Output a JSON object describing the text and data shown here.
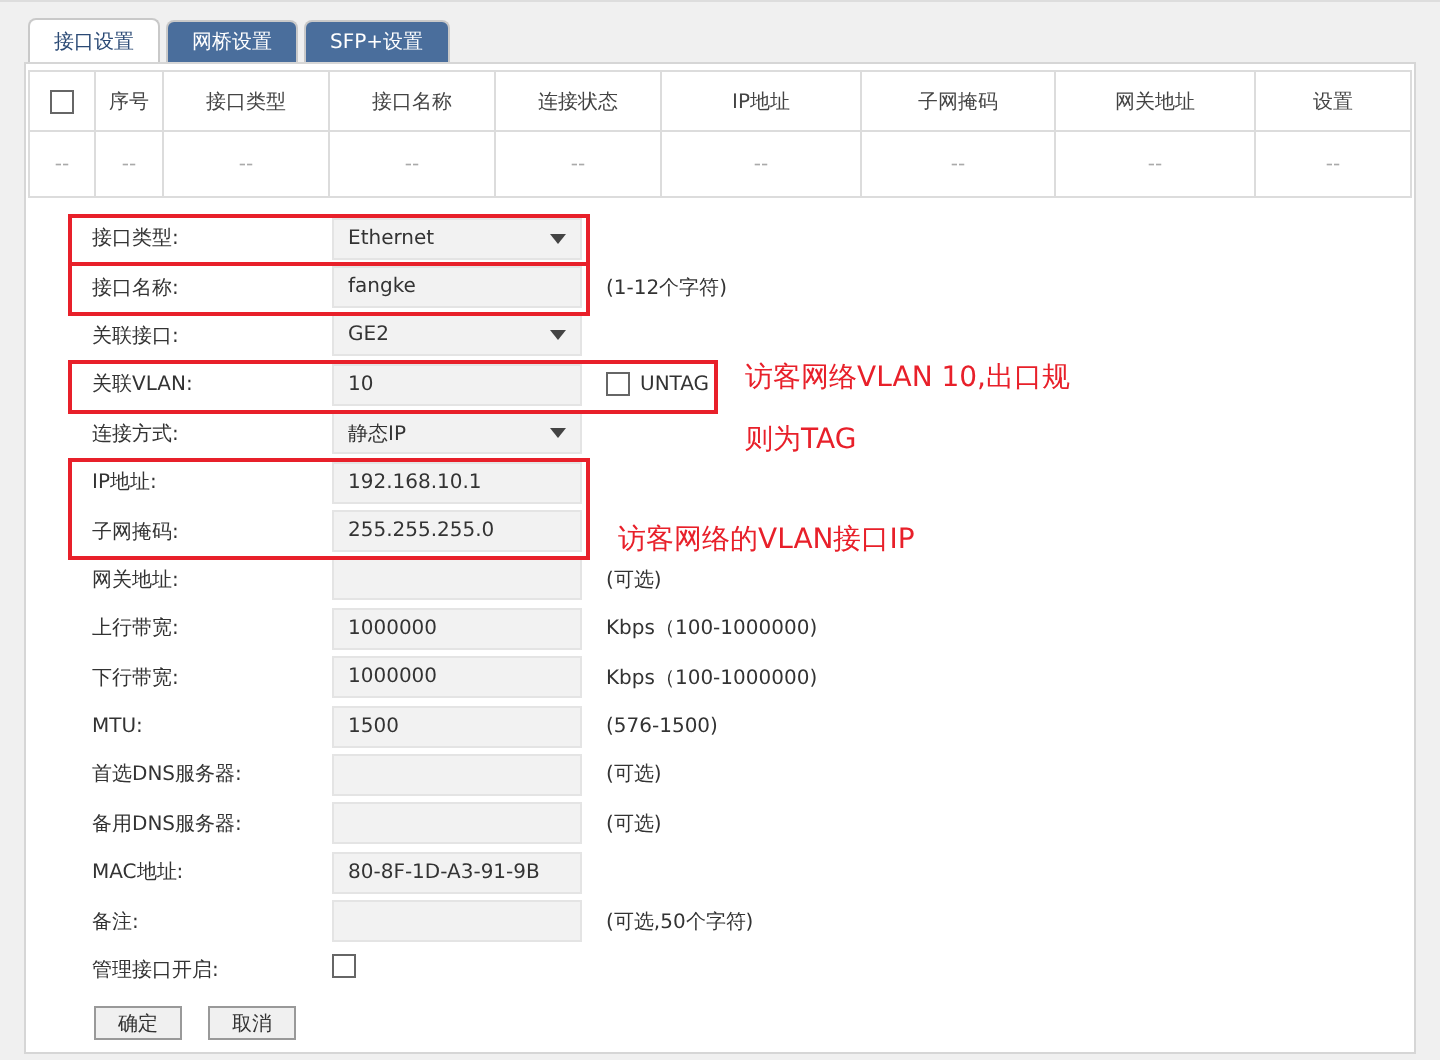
{
  "tabs": [
    {
      "label": "接口设置",
      "selected": true
    },
    {
      "label": "网桥设置",
      "selected": false
    },
    {
      "label": "SFP+设置",
      "selected": false
    }
  ],
  "table": {
    "select_all": {
      "checked": false
    },
    "columns": [
      "",
      "序号",
      "接口类型",
      "接口名称",
      "连接状态",
      "IP地址",
      "子网掩码",
      "网关地址",
      "设置"
    ],
    "rows": [
      [
        "--",
        "--",
        "--",
        "--",
        "--",
        "--",
        "--",
        "--",
        "--"
      ]
    ]
  },
  "form": {
    "rows": [
      {
        "kind": "highlight",
        "fields": [
          {
            "kind": "select",
            "label": "接口类型:",
            "value": "Ethernet"
          }
        ]
      },
      {
        "kind": "highlight",
        "fields": [
          {
            "kind": "input",
            "label": "接口名称:",
            "value": "fangke",
            "note": "(1-12个字符)"
          }
        ]
      },
      {
        "kind": "field",
        "field": {
          "kind": "select",
          "label": "关联接口:",
          "value": "GE2"
        }
      },
      {
        "kind": "highlight",
        "note": "访客网络VLAN 10,出口规则为TAG",
        "fields": [
          {
            "kind": "input",
            "label": "关联VLAN:",
            "value": "10",
            "option": {
              "label": "UNTAG",
              "checked": false
            }
          }
        ]
      },
      {
        "kind": "field",
        "field": {
          "kind": "select",
          "label": "连接方式:",
          "value": "静态IP"
        }
      },
      {
        "kind": "highlight",
        "note": "访客网络的VLAN接口IP",
        "fields": [
          {
            "kind": "input",
            "label": "IP地址:",
            "value": "192.168.10.1"
          },
          {
            "kind": "input",
            "label": "子网掩码:",
            "value": "255.255.255.0"
          }
        ]
      },
      {
        "kind": "field",
        "field": {
          "kind": "input",
          "label": "网关地址:",
          "note": "(可选)"
        }
      },
      {
        "kind": "field",
        "field": {
          "kind": "input",
          "label": "上行带宽:",
          "value": "1000000",
          "note": "Kbps（100-1000000)"
        }
      },
      {
        "kind": "field",
        "field": {
          "kind": "input",
          "label": "下行带宽:",
          "value": "1000000",
          "note": "Kbps（100-1000000)"
        }
      },
      {
        "kind": "field",
        "field": {
          "kind": "input",
          "label": "MTU:",
          "value": "1500",
          "note": "(576-1500)"
        }
      },
      {
        "kind": "field",
        "field": {
          "kind": "input",
          "label": "首选DNS服务器:",
          "note": "(可选)"
        }
      },
      {
        "kind": "field",
        "field": {
          "kind": "input",
          "label": "备用DNS服务器:",
          "note": "(可选)"
        }
      },
      {
        "kind": "field",
        "field": {
          "kind": "input",
          "label": "MAC地址:",
          "value": "80-8F-1D-A3-91-9B"
        }
      },
      {
        "kind": "field",
        "field": {
          "kind": "input",
          "label": "备注:",
          "note": "(可选,50个字符)"
        }
      },
      {
        "kind": "field",
        "field": {
          "kind": "checkbox",
          "label": "管理接口开启:",
          "checked": false
        }
      }
    ]
  },
  "buttons": [
    "确定",
    "取消"
  ]
}
